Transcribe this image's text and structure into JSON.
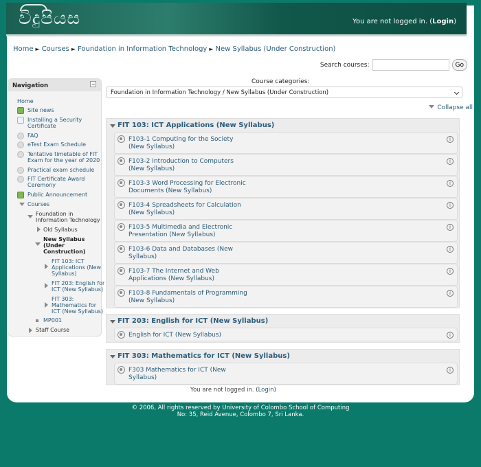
{
  "header": {
    "logo_text": "විදුපියස",
    "login_prefix": "You are not logged in. (",
    "login_link": "Login",
    "login_suffix": ")"
  },
  "breadcrumb": [
    "Home",
    "Courses",
    "Foundation in Information Technology",
    "New Syllabus (Under Construction)"
  ],
  "breadcrumb_sep": "►",
  "search": {
    "label": "Search courses:",
    "value": "",
    "button": "Go"
  },
  "navigation": {
    "title": "Navigation",
    "items": [
      "Home",
      "Site news",
      "Installing a Security Certificate",
      "FAQ",
      "eTest Exam Schedule",
      "Tentative timetable of FIT Exam for the year of 2020",
      "Practical exam schedule",
      "FIT Certificate Award Ceremony",
      "Public Announcement",
      "Courses",
      "Foundation in Information Technology",
      "Old Syllabus",
      "New Syllabus (Under Construction)",
      "FIT 103: ICT Applications (New Syllabus)",
      "FIT 203: English for ICT (New Syllabus)",
      "FIT 303: Mathematics for ICT (New Syllabus)",
      "MP001",
      "Staff Course"
    ]
  },
  "categories": {
    "label": "Course categories:",
    "selected": "Foundation in Information Technology / New Syllabus (Under Construction)"
  },
  "collapse_all": "Collapse all",
  "sections": [
    {
      "title": "FIT 103: ICT Applications (New Syllabus)",
      "modules": [
        [
          "F103-1 Computing for the Society",
          "(New Syllabus)"
        ],
        [
          "F103-2 Introduction to Computers",
          "(New Syllabus)"
        ],
        [
          "F103-3 Word Processing for Electronic",
          "Documents (New Syllabus)"
        ],
        [
          "F103-4 Spreadsheets for Calculation",
          "(New Syllabus)"
        ],
        [
          "F103-5 Multimedia and Electronic",
          "Presentation (New Syllabus)"
        ],
        [
          "F103-6 Data and Databases (New",
          "Syllabus)"
        ],
        [
          "F103-7 The Internet and Web",
          "Applications (New Syllabus)"
        ],
        [
          "F103-8 Fundamentals of Programming",
          "(New Syllabus)"
        ]
      ]
    },
    {
      "title": "FIT 203: English for ICT (New Syllabus)",
      "modules": [
        [
          "English for ICT (New Syllabus)",
          ""
        ]
      ]
    },
    {
      "title": "FIT 303: Mathematics for ICT (New Syllabus)",
      "modules": [
        [
          "F303 Mathematics for ICT (New",
          "Syllabus)"
        ]
      ]
    }
  ],
  "footer": {
    "login_prefix": "You are not logged in. (",
    "login_link": "Login",
    "login_suffix": ")",
    "copyright_1": "© 2006, All rights reserved by University of Colombo School of Computing",
    "copyright_2": "No: 35, Reid Avenue, Colombo 7, Sri Lanka."
  }
}
